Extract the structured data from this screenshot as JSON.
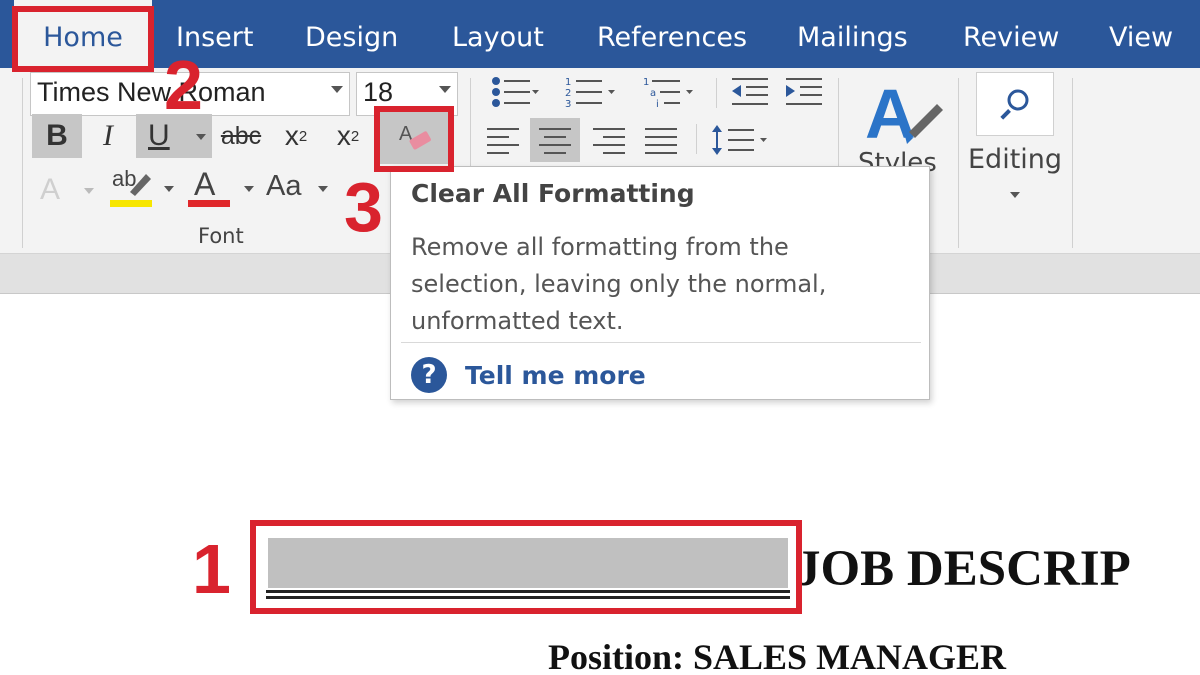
{
  "tabs": [
    "Home",
    "Insert",
    "Design",
    "Layout",
    "References",
    "Mailings",
    "Review",
    "View"
  ],
  "font_group": {
    "font_name": "Times New Roman",
    "font_size": "18",
    "bold": "B",
    "italic": "I",
    "underline": "U",
    "strikethrough": "abc",
    "subscript": "x",
    "subscript_mark": "2",
    "superscript": "x",
    "superscript_mark": "2",
    "text_effects": "A",
    "highlight": "ab",
    "font_color": "A",
    "change_case": "Aa",
    "label": "Font"
  },
  "styles_group": {
    "label": "Styles"
  },
  "editing_group": {
    "label": "Editing"
  },
  "tooltip": {
    "title": "Clear All Formatting",
    "description": "Remove all formatting from the selection, leaving only the normal, unformatted text.",
    "help_link": "Tell me more"
  },
  "annotations": {
    "step1": "1",
    "step2": "2",
    "step3": "3"
  },
  "document": {
    "title": "JOB DESCRIP",
    "position_line": "Position: SALES MANAGER"
  },
  "colors": {
    "ribbon_tab_bar": "#2b579a",
    "ribbon_bg": "#f3f3f3",
    "annotation_red": "#d9232e",
    "highlight_yellow": "#f7e600",
    "font_color_red": "#e0272a"
  }
}
